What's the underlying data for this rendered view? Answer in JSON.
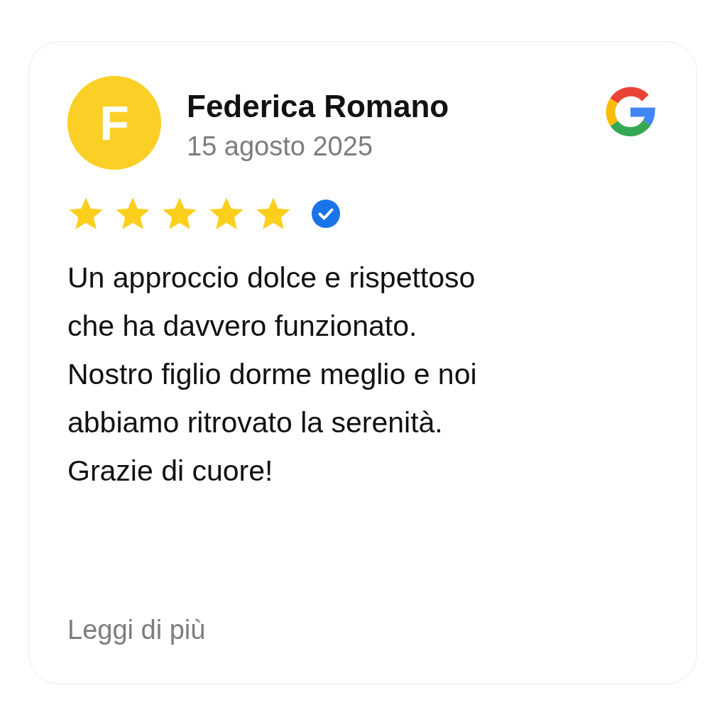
{
  "review": {
    "avatar_letter": "F",
    "author": "Federica Romano",
    "date": "15 agosto 2025",
    "stars": 5,
    "verified": true,
    "text": "Un approccio dolce e rispettoso\nche ha davvero funzionato.\nNostro figlio dorme meglio e noi\nabbiamo ritrovato la serenità.\nGrazie di cuore!",
    "more_link": "Leggi di più"
  }
}
